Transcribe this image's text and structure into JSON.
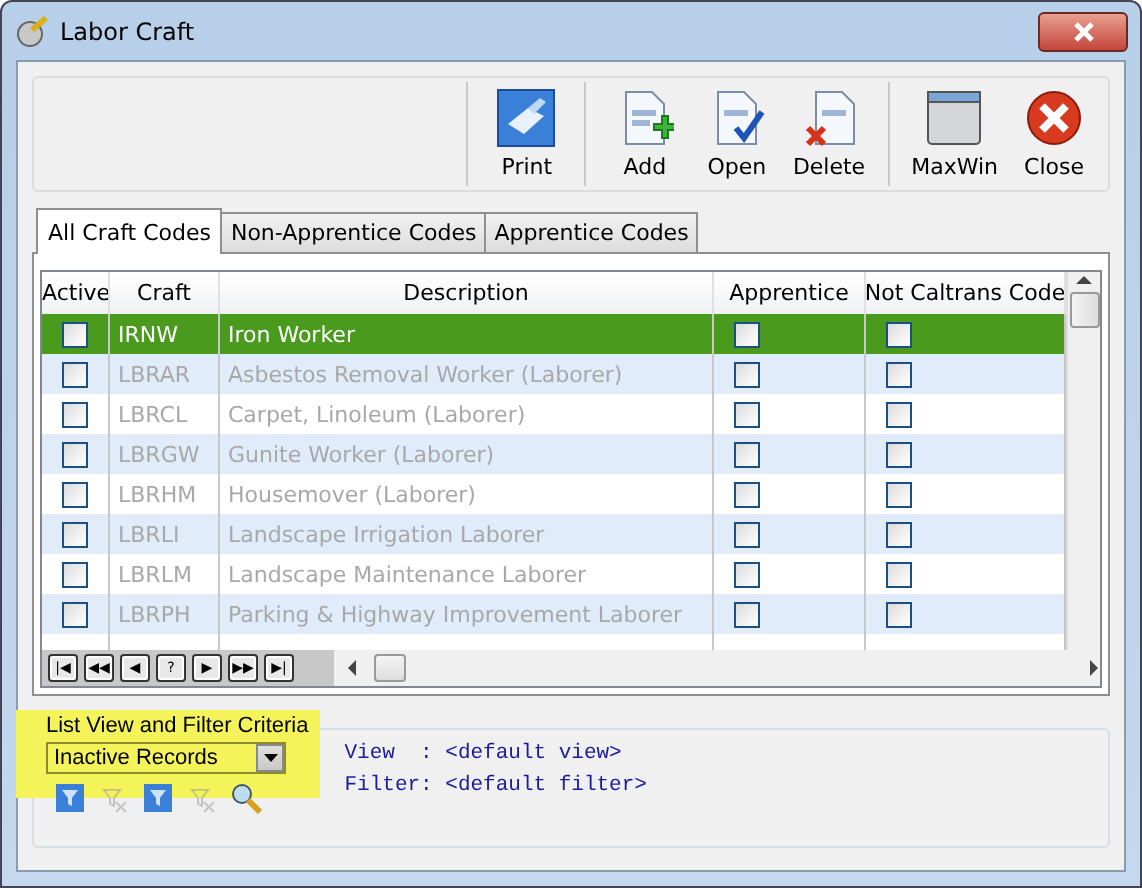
{
  "window": {
    "title": "Labor Craft"
  },
  "toolbar": [
    {
      "kind": "separator"
    },
    {
      "label": "Print",
      "kind": "print"
    },
    {
      "kind": "separator"
    },
    {
      "label": "Add",
      "kind": "add"
    },
    {
      "label": "Open",
      "kind": "open"
    },
    {
      "label": "Delete",
      "kind": "delete"
    },
    {
      "kind": "separator"
    },
    {
      "label": "MaxWin",
      "kind": "maxwin"
    },
    {
      "label": "Close",
      "kind": "close"
    }
  ],
  "tabs": [
    {
      "label": "All Craft Codes",
      "selected": true
    },
    {
      "label": "Non-Apprentice Codes",
      "selected": false
    },
    {
      "label": "Apprentice Codes",
      "selected": false
    }
  ],
  "table": {
    "columns": [
      "Active",
      "Craft",
      "Description",
      "Apprentice",
      "Not Caltrans Code"
    ],
    "rows": [
      {
        "active": false,
        "craft": "IRNW",
        "description": "Iron Worker",
        "apprentice": false,
        "not_caltrans": false,
        "selected": true
      },
      {
        "active": false,
        "craft": "LBRAR",
        "description": "Asbestos Removal Worker (Laborer)",
        "apprentice": false,
        "not_caltrans": false,
        "selected": false
      },
      {
        "active": false,
        "craft": "LBRCL",
        "description": "Carpet, Linoleum (Laborer)",
        "apprentice": false,
        "not_caltrans": false,
        "selected": false
      },
      {
        "active": false,
        "craft": "LBRGW",
        "description": "Gunite Worker (Laborer)",
        "apprentice": false,
        "not_caltrans": false,
        "selected": false
      },
      {
        "active": false,
        "craft": "LBRHM",
        "description": "Housemover (Laborer)",
        "apprentice": false,
        "not_caltrans": false,
        "selected": false
      },
      {
        "active": false,
        "craft": "LBRLI",
        "description": "Landscape Irrigation Laborer",
        "apprentice": false,
        "not_caltrans": false,
        "selected": false
      },
      {
        "active": false,
        "craft": "LBRLM",
        "description": "Landscape Maintenance Laborer",
        "apprentice": false,
        "not_caltrans": false,
        "selected": false
      },
      {
        "active": false,
        "craft": "LBRPH",
        "description": "Parking & Highway Improvement Laborer",
        "apprentice": false,
        "not_caltrans": false,
        "selected": false
      }
    ],
    "navigator": [
      "|◀",
      "◀◀",
      "◀",
      "?",
      "▶",
      "▶▶",
      "▶|"
    ]
  },
  "filter": {
    "legend": "List View and Filter Criteria",
    "dropdown_value": "Inactive Records",
    "tools": [
      {
        "kind": "filter",
        "disabled": false
      },
      {
        "kind": "clear",
        "disabled": true
      },
      {
        "kind": "filter",
        "disabled": false
      },
      {
        "kind": "clear",
        "disabled": true
      },
      {
        "kind": "zoom",
        "disabled": false
      }
    ],
    "view_line": "View  : <default view>",
    "filter_line": "Filter: <default filter>"
  }
}
